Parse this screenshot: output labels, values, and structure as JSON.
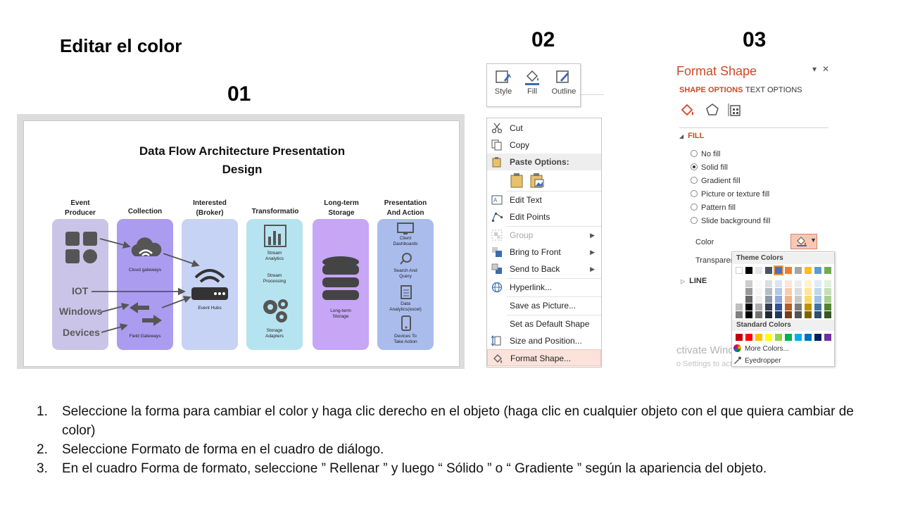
{
  "slide_title": "Editar el color",
  "steps": {
    "s1": "01",
    "s2": "02",
    "s3": "03"
  },
  "thumbnail": {
    "title_line1": "Data Flow Architecture Presentation",
    "title_line2": "Design",
    "columns": [
      {
        "head": "Event\nProducer",
        "color": "#c9c4e8"
      },
      {
        "head": "Collection",
        "color": "#ab9cf0"
      },
      {
        "head": "Interested\n(Broker)",
        "color": "#c6d3f5"
      },
      {
        "head": "Transformatio",
        "color": "#b6e3f0"
      },
      {
        "head": "Long-term\nStorage",
        "color": "#c6a6f5"
      },
      {
        "head": "Presentation\nAnd Action",
        "color": "#a9bcec"
      }
    ],
    "left_labels": [
      "IOT",
      "Windows",
      "Devices"
    ],
    "captions": {
      "cloud_gateways": "Cloud gateways",
      "field_gateways": "Field Gateways",
      "event_hubs": "Event Hubs",
      "stream_analytics": "Stream\nAnalytics",
      "stream_processing": "Stream\nProcessing",
      "storage_adapters": "Storage\nAdapters",
      "long_term_storage": "Long-term\nStorage",
      "client_dashboards": "Client\nDashboards",
      "search_query": "Search And\nQuery",
      "data_analytics": "Data\nAnalytics(excel)",
      "devices_action": "Devices To\nTake Action"
    }
  },
  "mini_toolbar": {
    "style": "Style",
    "fill": "Fill",
    "outline": "Outline"
  },
  "context_menu": {
    "cut": "Cut",
    "copy": "Copy",
    "paste_options": "Paste Options:",
    "edit_text": "Edit Text",
    "edit_points": "Edit Points",
    "group": "Group",
    "bring_to_front": "Bring to Front",
    "send_to_back": "Send to Back",
    "hyperlink": "Hyperlink...",
    "save_as_picture": "Save as Picture...",
    "set_default_shape": "Set as Default Shape",
    "size_position": "Size and Position...",
    "format_shape": "Format Shape..."
  },
  "format_pane": {
    "title": "Format Shape",
    "dropdown_glyph": "▾",
    "close_glyph": "✕",
    "tab_shape_options": "SHAPE OPTIONS",
    "tab_text_options": "TEXT OPTIONS",
    "fill_section": "FILL",
    "fill_options": [
      "No fill",
      "Solid fill",
      "Gradient fill",
      "Picture or texture fill",
      "Pattern fill",
      "Slide background fill"
    ],
    "selected_fill": "Solid fill",
    "color_label": "Color",
    "transparency_label": "Transparen",
    "line_section": "LINE",
    "theme_colors": "Theme Colors",
    "standard_colors": "Standard Colors",
    "more_colors": "More Colors...",
    "eyedropper": "Eyedropper",
    "watermark_line1": "ctivate Windo",
    "watermark_line2": "o Settings to activate Windows",
    "theme_palette": [
      "#ffffff",
      "#000000",
      "#e7e6e6",
      "#44546a",
      "#4472c4",
      "#ed7d31",
      "#a5a5a5",
      "#ffc000",
      "#5b9bd5",
      "#70ad47"
    ],
    "standard_palette": [
      "#c00000",
      "#ff0000",
      "#ffc000",
      "#ffff00",
      "#92d050",
      "#00b050",
      "#00b0f0",
      "#0070c0",
      "#002060",
      "#7030a0"
    ]
  },
  "instructions": [
    {
      "n": "1.",
      "text": "Seleccione la forma para cambiar el color y haga clic derecho en el objeto (haga clic en cualquier objeto con el que quiera cambiar de color)"
    },
    {
      "n": "2.",
      "text": "Seleccione Formato de forma en el cuadro de diálogo."
    },
    {
      "n": "3.",
      "text": "En el cuadro Forma de formato, seleccione ” Rellenar ” y luego “ Sólido ” o “ Gradiente ” según la apariencia del objeto."
    }
  ]
}
